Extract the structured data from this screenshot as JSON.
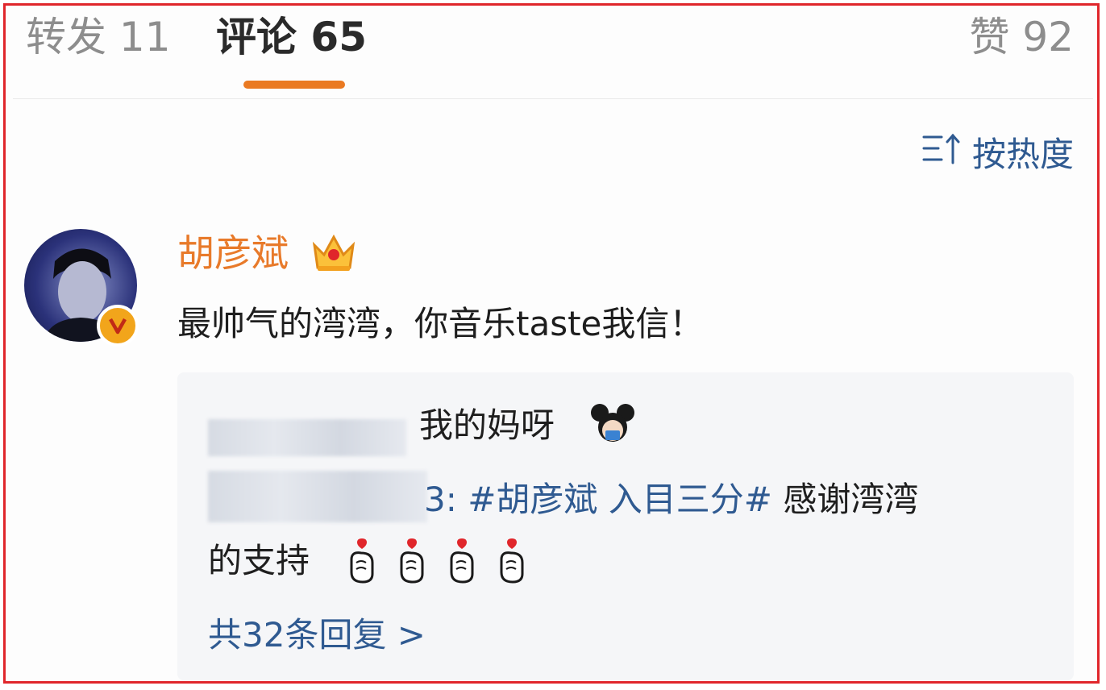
{
  "tabs": {
    "repost": "转发 11",
    "comment": "评论 65",
    "like": "赞 92"
  },
  "colors": {
    "active_indicator": "#ea7a22",
    "link_blue": "#2f5a91",
    "username_orange": "#e87a2a",
    "frame_red": "#e0262b"
  },
  "sort": {
    "label": "按热度",
    "icon": "sort-icon"
  },
  "comment": {
    "username": "胡彦斌",
    "badge_icon": "crown-icon",
    "verified_icon": "verified-badge-icon",
    "text": "最帅气的湾湾，你音乐taste我信！"
  },
  "replies": {
    "reply1_text": "我的妈呀",
    "reply1_emoji": "mickey-icon",
    "reply2_colon": "3:",
    "reply2_hashtag": "#胡彦斌 入目三分#",
    "reply2_text": " 感谢湾湾",
    "reply3_text": "的支持",
    "reply3_emoji": "finger-heart-icon",
    "more_link": "共32条回复 >"
  }
}
